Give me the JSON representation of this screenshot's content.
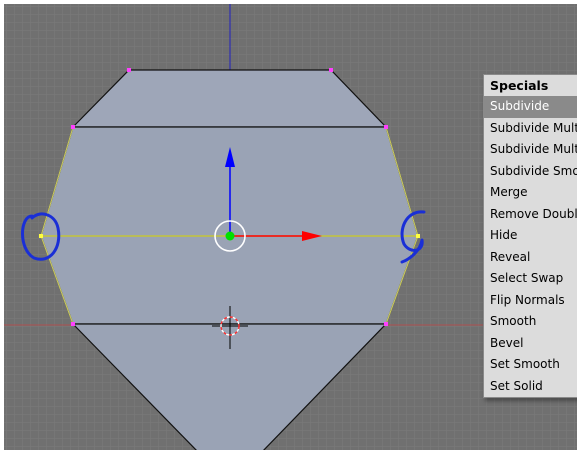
{
  "app": "3D mesh edit viewport",
  "colors": {
    "viewport_bg": "#707070",
    "grid_line": "#7c7c7c",
    "mesh_fill": "#9aa3b5",
    "mesh_edge": "#000000",
    "selected_vertex": "#ff00ff",
    "axis_x": "#ff0000",
    "axis_y": "#0000ff",
    "axis_z": "#0000ff",
    "edge_loop": "#cccc00",
    "annotation": "#1a2fd6",
    "menu_bg": "#dcdcdc",
    "menu_selected": "#8a8a8a"
  },
  "icons": [
    "transform-manipulator-icon",
    "3d-cursor-icon",
    "vertex-circle-annotation-icon"
  ],
  "specials_menu": {
    "title": "Specials",
    "items": [
      {
        "label": "Subdivide",
        "selected": true
      },
      {
        "label": "Subdivide Mult"
      },
      {
        "label": "Subdivide Mult"
      },
      {
        "label": "Subdivide Smo"
      },
      {
        "label": "Merge"
      },
      {
        "label": "Remove Double"
      },
      {
        "label": "Hide"
      },
      {
        "label": "Reveal"
      },
      {
        "label": "Select Swap"
      },
      {
        "label": "Flip Normals"
      },
      {
        "label": "Smooth"
      },
      {
        "label": "Bevel"
      },
      {
        "label": "Set Smooth"
      },
      {
        "label": "Set Solid"
      }
    ]
  }
}
